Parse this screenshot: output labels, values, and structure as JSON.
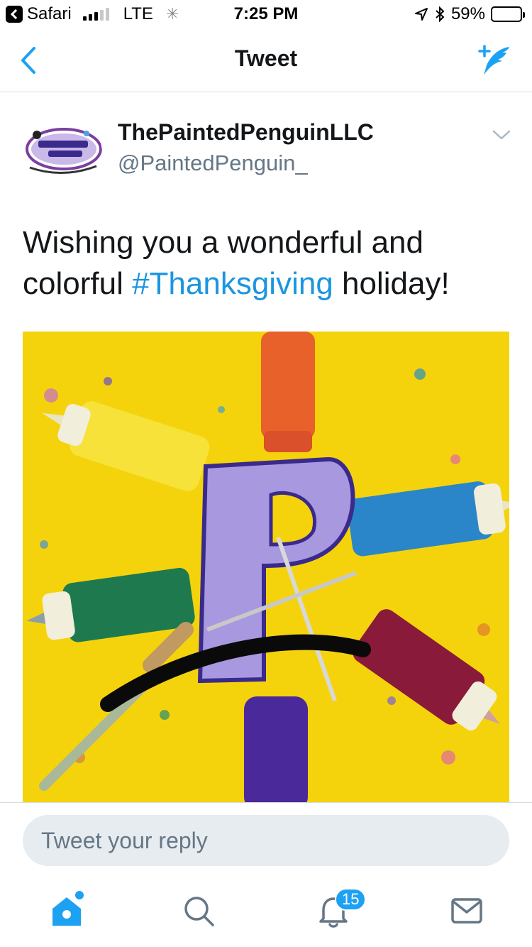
{
  "status_bar": {
    "back_app": "Safari",
    "network": "LTE",
    "time": "7:25 PM",
    "battery_text": "59%",
    "battery_level": 0.59
  },
  "nav": {
    "title": "Tweet",
    "back_icon": "chevron-left-icon",
    "compose_icon": "compose-feather-icon"
  },
  "tweet": {
    "author_name": "ThePaintedPenguinLLC",
    "handle": "@PaintedPenguin_",
    "text_before": "Wishing you a wonderful and colorful ",
    "hashtag": "#Thanksgiving",
    "text_after": " holiday!",
    "media_description_icon": "photo"
  },
  "reply": {
    "placeholder": "Tweet your reply"
  },
  "tabs": [
    {
      "name": "home",
      "icon": "home-icon",
      "active": true
    },
    {
      "name": "search",
      "icon": "search-icon",
      "active": false
    },
    {
      "name": "notifications",
      "icon": "bell-icon",
      "active": false,
      "badge": "15"
    },
    {
      "name": "messages",
      "icon": "mail-icon",
      "active": false
    }
  ],
  "colors": {
    "accent": "#1da1f2",
    "hashtag": "#1b95e0",
    "text": "#14171a",
    "secondary": "#657786"
  }
}
